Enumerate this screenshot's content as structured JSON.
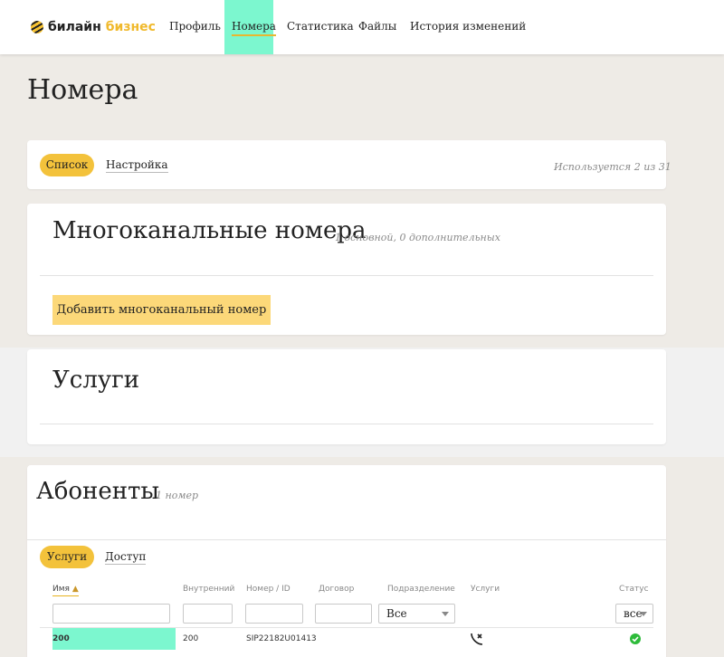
{
  "header": {
    "logo_part1": "билайн",
    "logo_part2": "бизнес",
    "nav": [
      {
        "label": "Профиль",
        "active": false
      },
      {
        "label": "Номера",
        "active": true
      },
      {
        "label": "Статистика",
        "active": false
      },
      {
        "label": "Файлы",
        "active": false
      },
      {
        "label": "История изменений",
        "active": false
      }
    ]
  },
  "page_title": "Номера",
  "tabs_card": {
    "active_tab": "Список",
    "tab2": "Настройка",
    "usage": "Используется 2 из 31"
  },
  "multichannel": {
    "title": "Многоканальные номера",
    "subtitle": "1 основной, 0 дополнительных",
    "add_button": "Добавить многоканальный номер"
  },
  "services": {
    "title": "Услуги"
  },
  "subscribers": {
    "title": "Абоненты",
    "subtitle": "1 номер",
    "active_tab": "Услуги",
    "tab2": "Доступ",
    "columns": {
      "name": "Имя",
      "internal": "Внутренний",
      "number_id": "Номер / ID",
      "contract": "Договор",
      "division": "Подразделение",
      "services": "Услуги",
      "status": "Статус"
    },
    "filters": {
      "division_value": "Все",
      "status_value": "все"
    },
    "rows": [
      {
        "name": "200",
        "internal": "200",
        "number_id": "SIP22182U01413",
        "status": "active"
      }
    ]
  },
  "colors": {
    "accent_yellow": "#f3c23b",
    "highlight_mint": "#7cf7cf",
    "status_green": "#2dbb3a"
  }
}
